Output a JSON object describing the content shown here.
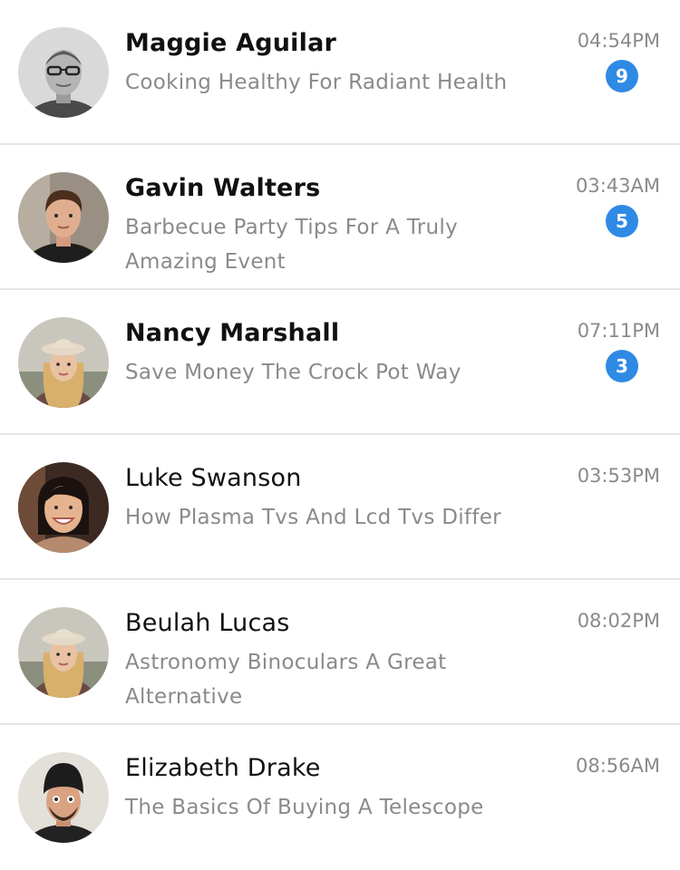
{
  "colors": {
    "badge": "#2f8ae4",
    "secondary_text": "#8a8a8a",
    "divider": "#e6e6e6"
  },
  "conversations": [
    {
      "name": "Maggie Aguilar",
      "preview": "Cooking Healthy For Radiant Health",
      "time": "04:54PM",
      "unread_count": "9",
      "avatar": "avatar-photo-man-glasses"
    },
    {
      "name": "Gavin Walters",
      "preview": "Barbecue Party Tips For A Truly Amazing Event",
      "time": "03:43AM",
      "unread_count": "5",
      "avatar": "avatar-photo-young-man"
    },
    {
      "name": "Nancy Marshall",
      "preview": "Save Money The Crock Pot Way",
      "time": "07:11PM",
      "unread_count": "3",
      "avatar": "avatar-photo-woman-hat"
    },
    {
      "name": "Luke Swanson",
      "preview": "How Plasma Tvs And Lcd Tvs Differ",
      "time": "03:53PM",
      "avatar": "avatar-photo-smiling-woman"
    },
    {
      "name": "Beulah Lucas",
      "preview": "Astronomy Binoculars A Great Alternative",
      "time": "08:02PM",
      "avatar": "avatar-photo-woman-hat"
    },
    {
      "name": "Elizabeth Drake",
      "preview": "The Basics Of Buying A Telescope",
      "time": "08:56AM",
      "avatar": "avatar-photo-man-beanie"
    }
  ]
}
